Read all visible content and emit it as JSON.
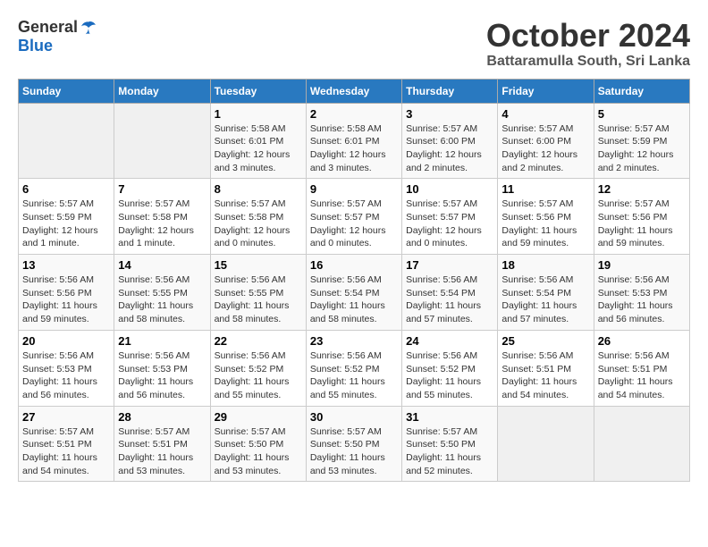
{
  "header": {
    "logo_general": "General",
    "logo_blue": "Blue",
    "month": "October 2024",
    "location": "Battaramulla South, Sri Lanka"
  },
  "weekdays": [
    "Sunday",
    "Monday",
    "Tuesday",
    "Wednesday",
    "Thursday",
    "Friday",
    "Saturday"
  ],
  "weeks": [
    [
      {
        "day": "",
        "info": ""
      },
      {
        "day": "",
        "info": ""
      },
      {
        "day": "1",
        "info": "Sunrise: 5:58 AM\nSunset: 6:01 PM\nDaylight: 12 hours\nand 3 minutes."
      },
      {
        "day": "2",
        "info": "Sunrise: 5:58 AM\nSunset: 6:01 PM\nDaylight: 12 hours\nand 3 minutes."
      },
      {
        "day": "3",
        "info": "Sunrise: 5:57 AM\nSunset: 6:00 PM\nDaylight: 12 hours\nand 2 minutes."
      },
      {
        "day": "4",
        "info": "Sunrise: 5:57 AM\nSunset: 6:00 PM\nDaylight: 12 hours\nand 2 minutes."
      },
      {
        "day": "5",
        "info": "Sunrise: 5:57 AM\nSunset: 5:59 PM\nDaylight: 12 hours\nand 2 minutes."
      }
    ],
    [
      {
        "day": "6",
        "info": "Sunrise: 5:57 AM\nSunset: 5:59 PM\nDaylight: 12 hours\nand 1 minute."
      },
      {
        "day": "7",
        "info": "Sunrise: 5:57 AM\nSunset: 5:58 PM\nDaylight: 12 hours\nand 1 minute."
      },
      {
        "day": "8",
        "info": "Sunrise: 5:57 AM\nSunset: 5:58 PM\nDaylight: 12 hours\nand 0 minutes."
      },
      {
        "day": "9",
        "info": "Sunrise: 5:57 AM\nSunset: 5:57 PM\nDaylight: 12 hours\nand 0 minutes."
      },
      {
        "day": "10",
        "info": "Sunrise: 5:57 AM\nSunset: 5:57 PM\nDaylight: 12 hours\nand 0 minutes."
      },
      {
        "day": "11",
        "info": "Sunrise: 5:57 AM\nSunset: 5:56 PM\nDaylight: 11 hours\nand 59 minutes."
      },
      {
        "day": "12",
        "info": "Sunrise: 5:57 AM\nSunset: 5:56 PM\nDaylight: 11 hours\nand 59 minutes."
      }
    ],
    [
      {
        "day": "13",
        "info": "Sunrise: 5:56 AM\nSunset: 5:56 PM\nDaylight: 11 hours\nand 59 minutes."
      },
      {
        "day": "14",
        "info": "Sunrise: 5:56 AM\nSunset: 5:55 PM\nDaylight: 11 hours\nand 58 minutes."
      },
      {
        "day": "15",
        "info": "Sunrise: 5:56 AM\nSunset: 5:55 PM\nDaylight: 11 hours\nand 58 minutes."
      },
      {
        "day": "16",
        "info": "Sunrise: 5:56 AM\nSunset: 5:54 PM\nDaylight: 11 hours\nand 58 minutes."
      },
      {
        "day": "17",
        "info": "Sunrise: 5:56 AM\nSunset: 5:54 PM\nDaylight: 11 hours\nand 57 minutes."
      },
      {
        "day": "18",
        "info": "Sunrise: 5:56 AM\nSunset: 5:54 PM\nDaylight: 11 hours\nand 57 minutes."
      },
      {
        "day": "19",
        "info": "Sunrise: 5:56 AM\nSunset: 5:53 PM\nDaylight: 11 hours\nand 56 minutes."
      }
    ],
    [
      {
        "day": "20",
        "info": "Sunrise: 5:56 AM\nSunset: 5:53 PM\nDaylight: 11 hours\nand 56 minutes."
      },
      {
        "day": "21",
        "info": "Sunrise: 5:56 AM\nSunset: 5:53 PM\nDaylight: 11 hours\nand 56 minutes."
      },
      {
        "day": "22",
        "info": "Sunrise: 5:56 AM\nSunset: 5:52 PM\nDaylight: 11 hours\nand 55 minutes."
      },
      {
        "day": "23",
        "info": "Sunrise: 5:56 AM\nSunset: 5:52 PM\nDaylight: 11 hours\nand 55 minutes."
      },
      {
        "day": "24",
        "info": "Sunrise: 5:56 AM\nSunset: 5:52 PM\nDaylight: 11 hours\nand 55 minutes."
      },
      {
        "day": "25",
        "info": "Sunrise: 5:56 AM\nSunset: 5:51 PM\nDaylight: 11 hours\nand 54 minutes."
      },
      {
        "day": "26",
        "info": "Sunrise: 5:56 AM\nSunset: 5:51 PM\nDaylight: 11 hours\nand 54 minutes."
      }
    ],
    [
      {
        "day": "27",
        "info": "Sunrise: 5:57 AM\nSunset: 5:51 PM\nDaylight: 11 hours\nand 54 minutes."
      },
      {
        "day": "28",
        "info": "Sunrise: 5:57 AM\nSunset: 5:51 PM\nDaylight: 11 hours\nand 53 minutes."
      },
      {
        "day": "29",
        "info": "Sunrise: 5:57 AM\nSunset: 5:50 PM\nDaylight: 11 hours\nand 53 minutes."
      },
      {
        "day": "30",
        "info": "Sunrise: 5:57 AM\nSunset: 5:50 PM\nDaylight: 11 hours\nand 53 minutes."
      },
      {
        "day": "31",
        "info": "Sunrise: 5:57 AM\nSunset: 5:50 PM\nDaylight: 11 hours\nand 52 minutes."
      },
      {
        "day": "",
        "info": ""
      },
      {
        "day": "",
        "info": ""
      }
    ]
  ]
}
